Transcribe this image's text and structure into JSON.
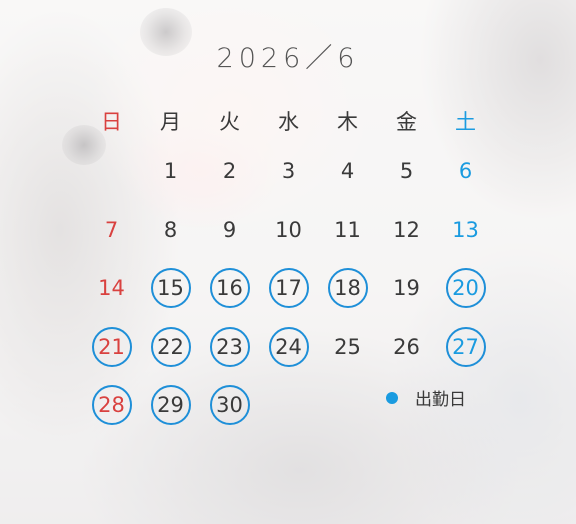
{
  "calendar": {
    "title": "2026／6",
    "weekdays": [
      "日",
      "月",
      "火",
      "水",
      "木",
      "金",
      "土"
    ],
    "weeks": [
      [
        null,
        1,
        2,
        3,
        4,
        5,
        6
      ],
      [
        7,
        8,
        9,
        10,
        11,
        12,
        13
      ],
      [
        14,
        15,
        16,
        17,
        18,
        19,
        20
      ],
      [
        21,
        22,
        23,
        24,
        25,
        26,
        27
      ],
      [
        28,
        29,
        30,
        null,
        null,
        null,
        null
      ]
    ],
    "working_days": [
      15,
      16,
      17,
      18,
      20,
      21,
      22,
      23,
      24,
      27,
      28,
      29,
      30
    ]
  },
  "legend": {
    "label": "出勤日"
  },
  "colors": {
    "sunday": "#d9413f",
    "saturday": "#1a9be0",
    "work_ring": "#1e8fd8",
    "text": "#3a3a3a"
  }
}
